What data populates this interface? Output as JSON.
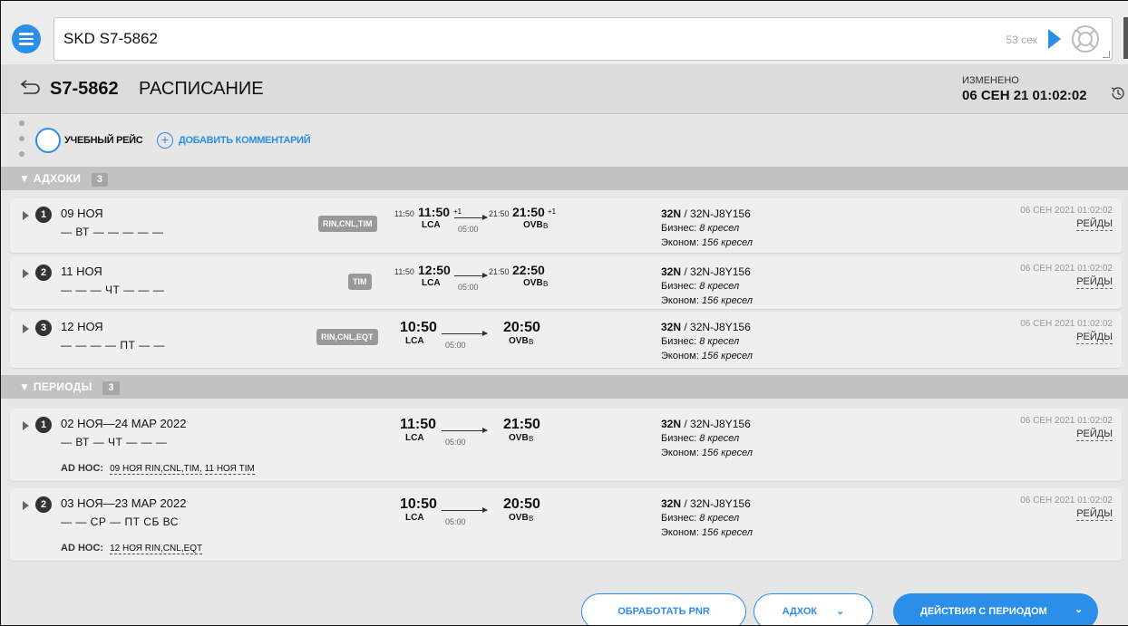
{
  "search": {
    "query": "SKD S7-5862",
    "timer": "53 сек"
  },
  "header": {
    "code": "S7-5862",
    "title": "РАСПИСАНИЕ",
    "changed_label": "ИЗМЕНЕНО",
    "changed_value": "06 СЕН 21 01:02:02"
  },
  "toolbar": {
    "training_label": "УЧЕБНЫЙ РЕЙС",
    "add_comment_label": "ДОБАВИТЬ КОММЕНТАРИЙ"
  },
  "adhocs": {
    "title": "АДХОКИ",
    "count": "3",
    "items": [
      {
        "num": "1",
        "date": "09 НОЯ",
        "days": "— ВТ — — — — —",
        "codes": "RIN,CNL,TIM",
        "orig_dep": "11:50",
        "dep": "11:50",
        "dep_plus": "+1",
        "orig_arr": "21:50",
        "arr": "21:50",
        "arr_plus": "+1",
        "from": "LCA",
        "to": "OVB",
        "to_sub": "B",
        "duration": "05:00",
        "aircraft": "32N",
        "config": "32N-J8Y156",
        "business_label": "Бизнес:",
        "business_val": "8 кресел",
        "economy_label": "Эконом:",
        "economy_val": "156 кресел",
        "stamp": "06 СЕН 2021 01:02:02",
        "raids": "РЕЙДЫ"
      },
      {
        "num": "2",
        "date": "11 НОЯ",
        "days": "— — — ЧТ — — —",
        "codes": "TIM",
        "orig_dep": "11:50",
        "dep": "12:50",
        "dep_plus": "",
        "orig_arr": "21:50",
        "arr": "22:50",
        "arr_plus": "",
        "from": "LCA",
        "to": "OVB",
        "to_sub": "B",
        "duration": "05:00",
        "aircraft": "32N",
        "config": "32N-J8Y156",
        "business_label": "Бизнес:",
        "business_val": "8 кресел",
        "economy_label": "Эконом:",
        "economy_val": "156 кресел",
        "stamp": "06 СЕН 2021 01:02:02",
        "raids": "РЕЙДЫ"
      },
      {
        "num": "3",
        "date": "12 НОЯ",
        "days": "— — — — ПТ — —",
        "codes": "RIN,CNL,EQT",
        "orig_dep": "",
        "dep": "10:50",
        "dep_plus": "",
        "orig_arr": "",
        "arr": "20:50",
        "arr_plus": "",
        "from": "LCA",
        "to": "OVB",
        "to_sub": "B",
        "duration": "05:00",
        "aircraft": "32N",
        "config": "32N-J8Y156",
        "business_label": "Бизнес:",
        "business_val": "8 кресел",
        "economy_label": "Эконом:",
        "economy_val": "156 кресел",
        "stamp": "06 СЕН 2021 01:02:02",
        "raids": "РЕЙДЫ"
      }
    ]
  },
  "periods": {
    "title": "ПЕРИОДЫ",
    "count": "3",
    "adhoc_label": "AD HOC:",
    "items": [
      {
        "num": "1",
        "date": "02 НОЯ—24 МАР 2022",
        "days": "— ВТ — ЧТ — — —",
        "dep": "11:50",
        "arr": "21:50",
        "from": "LCA",
        "to": "OVB",
        "to_sub": "B",
        "duration": "05:00",
        "aircraft": "32N",
        "config": "32N-J8Y156",
        "business_label": "Бизнес:",
        "business_val": "8 кресел",
        "economy_label": "Эконом:",
        "economy_val": "156 кресел",
        "stamp": "06 СЕН 2021 01:02:02",
        "raids": "РЕЙДЫ",
        "adhoc_link1": "09 НОЯ RIN,CNL,TIM,",
        "adhoc_link2": "11 НОЯ TIM"
      },
      {
        "num": "2",
        "date": "03 НОЯ—23 МАР 2022",
        "days": "— — СР — ПТ СБ ВС",
        "dep": "10:50",
        "arr": "20:50",
        "from": "LCA",
        "to": "OVB",
        "to_sub": "B",
        "duration": "05:00",
        "aircraft": "32N",
        "config": "32N-J8Y156",
        "business_label": "Бизнес:",
        "business_val": "8 кресел",
        "economy_label": "Эконом:",
        "economy_val": "156 кресел",
        "stamp": "06 СЕН 2021 01:02:02",
        "raids": "РЕЙДЫ",
        "adhoc_link1": "12 НОЯ RIN,CNL,EQT",
        "adhoc_link2": ""
      }
    ]
  },
  "footer": {
    "process_pnr": "ОБРАБОТАТЬ PNR",
    "adhoc": "АДХОК",
    "period_actions": "ДЕЙСТВИЯ С ПЕРИОДОМ"
  },
  "colors": {
    "accent": "#2b8ee8",
    "section_bg": "#c2c2c2",
    "row_bg": "#efefef"
  }
}
